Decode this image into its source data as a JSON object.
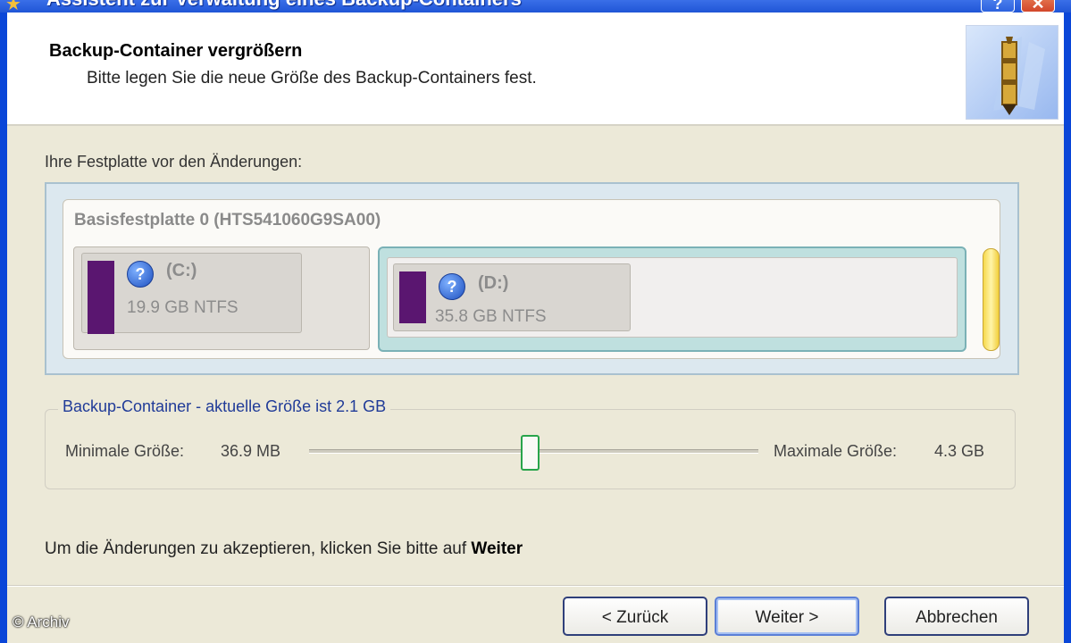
{
  "window": {
    "title": "Assistent zur Verwaltung eines Backup-Containers",
    "help_label": "?",
    "close_label": "✕"
  },
  "header": {
    "title": "Backup-Container vergrößern",
    "subtitle": "Bitte legen Sie die neue Größe des Backup-Containers fest."
  },
  "disk_section": {
    "label": "Ihre Festplatte vor den Änderungen:",
    "disk_name": "Basisfestplatte 0 (HTS541060G9SA00)",
    "partitions": [
      {
        "letter": "(C:)",
        "size": "19.9 GB NTFS",
        "color": "#5a1670"
      },
      {
        "letter": "(D:)",
        "size": "35.8 GB NTFS",
        "color": "#5a1670"
      }
    ]
  },
  "container": {
    "legend": "Backup-Container - aktuelle Größe ist 2.1 GB",
    "min_label": "Minimale Größe:",
    "min_value": "36.9 MB",
    "max_label": "Maximale Größe:",
    "max_value": "4.3 GB"
  },
  "accept": {
    "text": "Um die Änderungen zu akzeptieren, klicken Sie bitte auf ",
    "bold": "Weiter"
  },
  "buttons": {
    "back": "< Zurück",
    "next": "Weiter >",
    "cancel": "Abbrechen"
  },
  "watermark": "© Archiv",
  "colors": {
    "accent": "#0a46d8",
    "partition": "#5a1670",
    "container": "#f6d94d",
    "slider_thumb": "#28a44b"
  }
}
